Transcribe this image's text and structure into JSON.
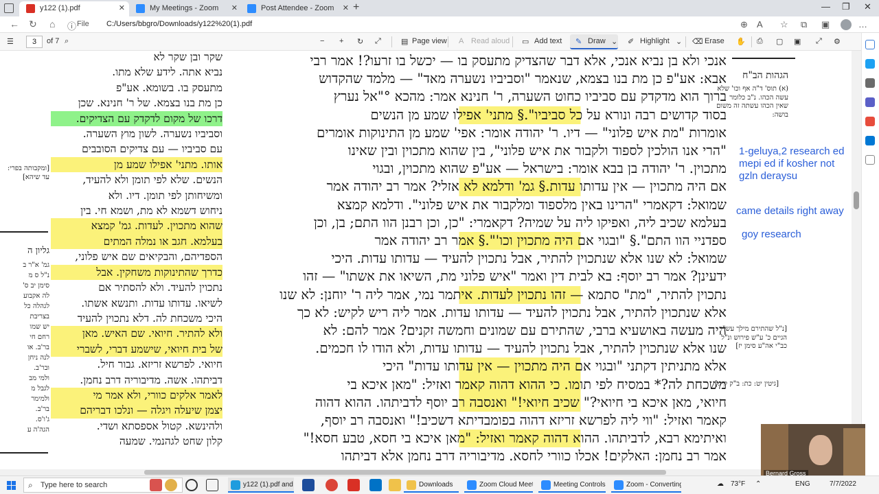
{
  "browser": {
    "tabs": [
      {
        "title": "y122 (1).pdf",
        "active": true,
        "icon": "pdf-icon"
      },
      {
        "title": "My Meetings - Zoom",
        "active": false,
        "icon": "zoom-icon"
      },
      {
        "title": "Post Attendee - Zoom",
        "active": false,
        "icon": "zoom-icon"
      }
    ],
    "new_tab": "+",
    "file_label": "File",
    "url": "C:/Users/bbgro/Downloads/y122%20(1).pdf"
  },
  "pdf_toolbar": {
    "page_input": "3",
    "page_count": "of 7",
    "page_view": "Page view",
    "read_aloud": "Read aloud",
    "add_text": "Add text",
    "draw": "Draw",
    "highlight": "Highlight",
    "erase": "Erase"
  },
  "annotations": {
    "note1": "1-geluya,2 research ed mepi ed if kosher not gzln deraysu",
    "note2": "came details right away",
    "note3": "goy research"
  },
  "document": {
    "main_lines": [
      "אנכי ולא בן נביא אנכי, אלא דבר שהצדיק מתעסק בו — יכשל בו זרעו?! אמר רבי",
      "אבא: אע\"פ כן מת בנו בצמא, שנאמר \"וסביביו נשערה מאד\" — מלמד שהקדוש",
      "ברוך הוא מדקדק עם סביביו כחוט השערה, ר' חנינא אמר: מהכא °\"אל נערץ",
      "בסוד קדושים רבה ונורא על כל סביביו\".§ מתני' אפילו שמע מן הנשים",
      "אומרות \"מת איש פלוני\" — דיו. ר' יהודה אומר: אפי' שמע מן התינוקות אומרים",
      "\"הרי אנו הולכין לספוד ולקבור את איש פלוני\", בין שהוא מתכוין ובין שאינו",
      "מתכוין. ר' יהודה בן בבא אומר: בישראל — אע\"פ שהוא מתכוין, ובגוי",
      "אם היה מתכוין — אין עדותו עדות.§ גמ' ודלמא לא אזלי? אמר רב יהודה אמר",
      "שמואל: דקאמרי \"הרינו באין מלספוד ומלקבור את איש פלוני\". ודלמא קמצא",
      "בעלמא שכיב ליה, ואפיקו ליה על שמיה? דקאמרי: \"כן, וכן רבנן הוו התם; בן, וכן",
      "ספדניי הוו התם\".§ \"ובגוי אם היה מתכוין וכו'\".§ אמר רב יהודה אמר",
      "שמואל: לא שנו אלא שנתכוין להתיר, אבל נתכוין להעיד — עדותו עדות. היכי",
      "ידעינן? אמר רב יוסף: בא לבית דין ואמר \"איש פלוני מת, השיאו את אשתו\" — זהו",
      "נתכוין להתיר, \"מת\" סתמא — זהו נתכוין לעדות. איתמר נמי, אמר ליה ר' יוחנן: לא שנו",
      "אלא שנתכוין להתיר, אבל נתכוין להעיד — עדותו עדות. אמר ליה ריש לקיש: לא כך",
      "היה מעשה באושעיא ברבי, שהתירם עם שמונים וחמשה זקנים? אמר להם: לא",
      "שנו אלא שנתכוין להתיר, אבל נתכוין להעיד — עדותו עדות, ולא הודו לו חכמים.",
      "אלא מתניתין דקתני \"ובגוי אם היה מתכוין — אין עדותו עדות\" היכי",
      "משכחת לה?* במסיח לפי תומו. כי ההוא דהוה קאמר ואזיל: \"מאן איכא בי",
      "חיואי, מאן איכא בי חיואי?\" שכיב חיואי!\" ואנסבה רב יוסף לדביתהו. ההוא דהוה",
      "קאמר ואזיל: \"ווי ליה לפרשא זריזא דהוה בפומבדיתא דשכיב!\" ואנסבה רב יוסף,",
      "ואיתימא רבא, לדביתהו. ההוא דהוה קאמר ואזיל: \"מאן איכא בי חסא, טבע חסא!\"",
      "אמר רב נחמן: האלקים! אכלו כוורי לחסא. מדיבוריה דרב נחמן אלא דביתהו"
    ],
    "side_lines": [
      "שקר ובן שקר לא",
      "נביא אתה. לידע שלא מתו.",
      "מתעסק בו. בשומא. אע\"פ",
      "כן מת בנו בצמא. של ר' חנינא. שכן",
      "דרכו של מקום לדקדק עם הצדיקים.",
      "וסביביו נשערה. לשון מוץ השערה.",
      "עם סביביו — עם צדיקים הסובבים",
      "אותו. מתני' אפילו שמע מן",
      "הנשים. שלא לפי תומן ולא להעיד,",
      "ומשיחותן לפי תומן. דיו. ולא",
      "ניחוש דשמא לא מת, ושמא חי. בין",
      "שהוא מתכוין. לעדות. גמ' קמצא",
      "בעלמא. חגב או נמלה המתים",
      "הספדיהם, והבקיאים שם איש פלוני,",
      "כדרך שהתינוקות משחקין. אבל",
      "נתכוין להעיד. ולא להסתיר אם",
      "לשיאו. עדותו עדות. ותנשא אשתו.",
      "היכי משכחת לה. דלא נתכוין להעיד",
      "ולא להתיר. חיואי. שם האיש. מאן",
      "של בית חיואי, שישמע דברי, לשברי",
      "חיואי. לפרשא זריזא. גבור חיל.",
      "דביתהו. אשה. מדיבוריה דרב נחמן.",
      "לאמר אלקים כוורי, ולא אמר מי",
      "יצמן שיעלה ויגלה — ונלכו דבריהם",
      "ולהינשא. קטול אספסתא ושדי.",
      "קלון שחט לגהנמי. שמעה"
    ],
    "right_header": "הגהות הב\"ח",
    "right_notes": [
      "(א) תוס' ד\"ה אף וכו' שלא",
      "עשה הכהו. נ\"ב כלומר",
      "שאין הכהו עשתה זה משום",
      "בושה:"
    ],
    "right_lower": [
      "[נ\"ל שהתירם מילך עש\"ר",
      "הגיים כ' ע\"ש פירוש ונ\"ל",
      "כב\"י אה\"ע סימן יז]"
    ],
    "right_bottom": "[גיטין יט: כת: ב\"ק קיז:]",
    "left_margin_top": [
      "[ומקבותה בפרי:",
      "עד שיהא]"
    ],
    "left_margin_header": "גליון ה",
    "left_margin_lines": [
      "גמ' א\"ר ב",
      "נ\"ל ס מ",
      "סימן יב ס'",
      "לה אקבוע",
      "לגהלה כל",
      "בצריבת",
      "יש שמו",
      "רחם חי",
      "בר'ב. או",
      "לנה ניחן",
      "ובר'ב.",
      "ולמי מב",
      "לגבל מ",
      "ולמימר",
      "בר'ב.",
      "ג'ו'ס.",
      "הגה'ה ע"
    ]
  },
  "self_view": {
    "name": "Bernard Gross"
  },
  "taskbar": {
    "search_placeholder": "Type here to search",
    "items": [
      {
        "label": "y122 (1).pdf and 2 ...",
        "icon": "edge-icon",
        "open": true
      },
      {
        "label": "Downloads",
        "icon": "folder-icon",
        "open": true
      },
      {
        "label": "Zoom Cloud Meeti...",
        "icon": "zoom-icon",
        "open": true
      },
      {
        "label": "Meeting Controls",
        "icon": "zoom-icon",
        "open": true
      },
      {
        "label": "Zoom - Converting...",
        "icon": "zoom-icon",
        "open": true
      }
    ],
    "temperature": "73°F",
    "lang": "ENG",
    "date": "7/7/2022"
  }
}
